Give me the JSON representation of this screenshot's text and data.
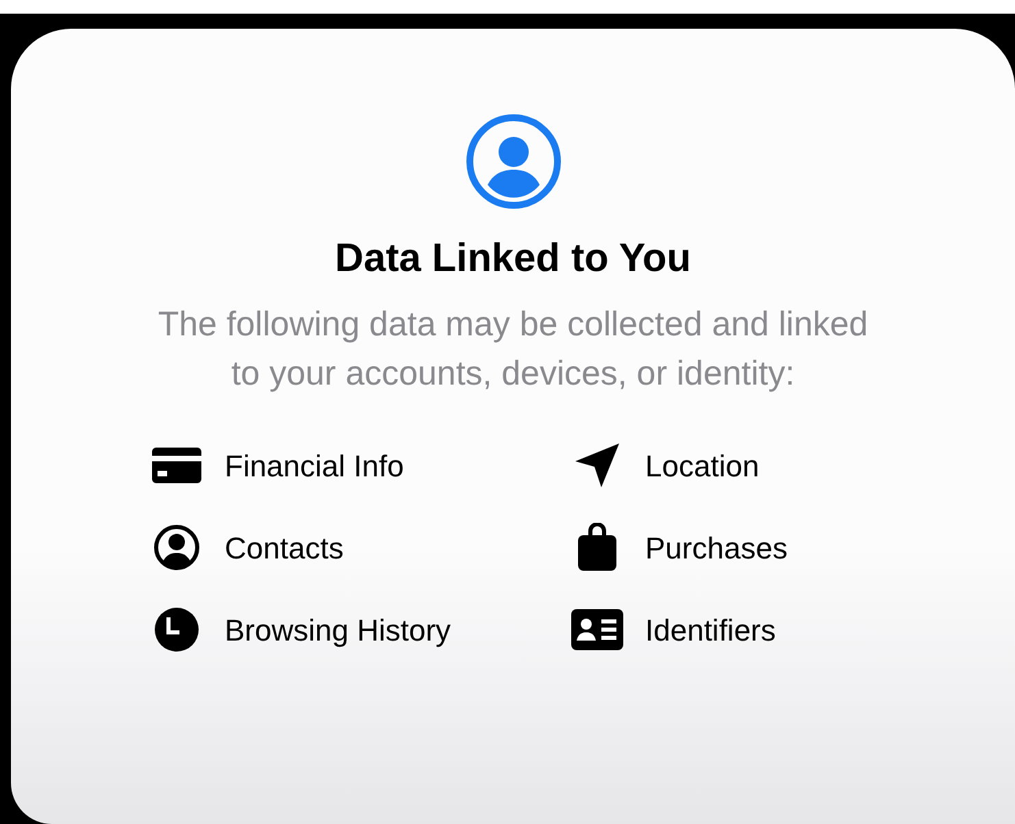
{
  "title": "Data Linked to You",
  "description": "The following data may be collected and linked to your accounts, devices, or identity:",
  "items": [
    {
      "kind": "card",
      "label": "Financial Info"
    },
    {
      "kind": "location",
      "label": "Location"
    },
    {
      "kind": "contact",
      "label": "Contacts"
    },
    {
      "kind": "bag",
      "label": "Purchases"
    },
    {
      "kind": "clock",
      "label": "Browsing History"
    },
    {
      "kind": "idcard",
      "label": "Identifiers"
    }
  ]
}
